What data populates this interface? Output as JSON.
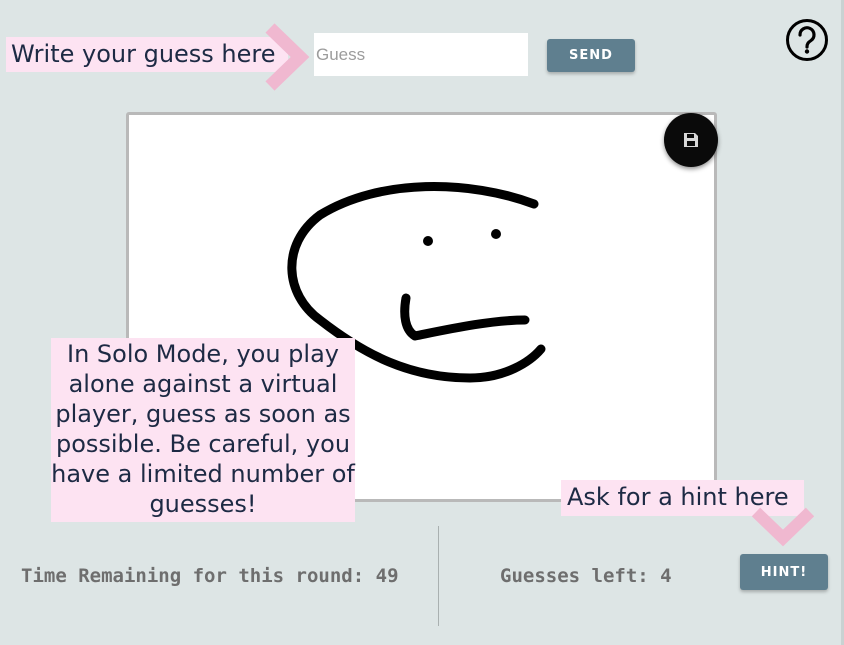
{
  "tooltips": {
    "guess": "Write your guess here",
    "solo": "In Solo Mode, you play alone against a virtual player, guess as soon as possible. Be careful, you have a limited number of guesses!",
    "hint": "Ask for a hint here"
  },
  "guess_input": {
    "value": "",
    "placeholder": "Guess"
  },
  "buttons": {
    "send": "SEND",
    "hint": "HINT!"
  },
  "icons": {
    "help": "question-circle-icon",
    "save": "floppy-disk-icon"
  },
  "status": {
    "time_label": "Time Remaining for this round:",
    "time_value": "49",
    "guesses_label": "Guesses left:",
    "guesses_value": "4"
  },
  "colors": {
    "background": "#dde5e5",
    "button": "#5f7f8f",
    "tooltip_bg": "#fde3f2",
    "chevron": "#f0b8d0"
  }
}
